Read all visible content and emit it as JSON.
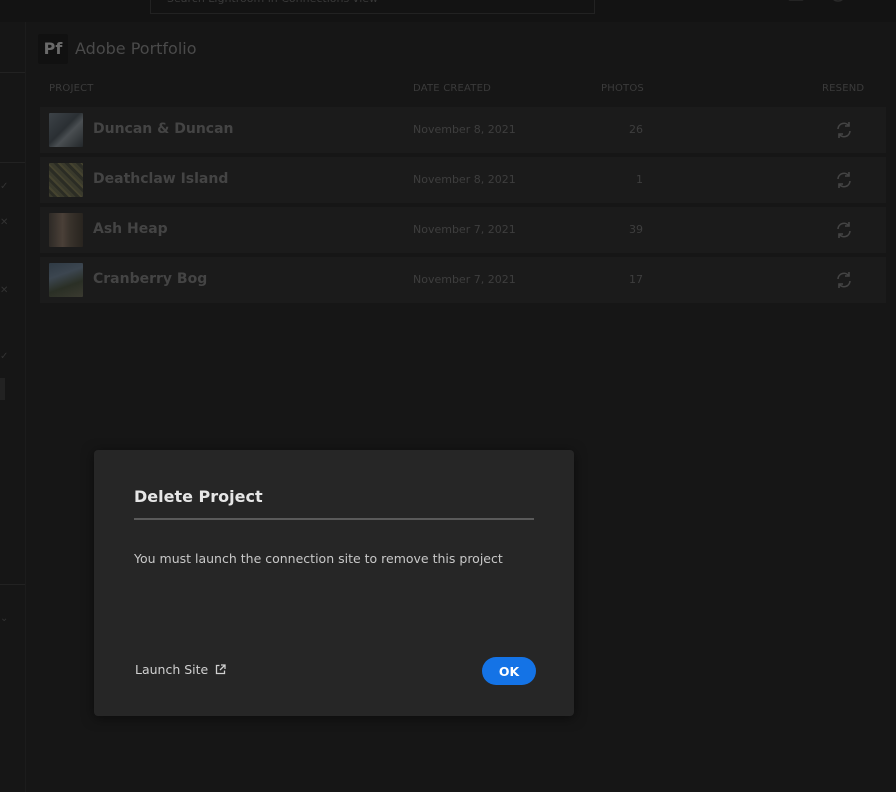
{
  "topbar": {
    "search_text": "Search Lightroom in Connections view"
  },
  "app": {
    "logo_text": "Pf",
    "title": "Adobe Portfolio"
  },
  "table": {
    "headers": {
      "project": "PROJECT",
      "date_created": "DATE CREATED",
      "photos": "PHOTOS",
      "resend": "RESEND"
    },
    "rows": [
      {
        "name": "Duncan & Duncan",
        "date": "November 8, 2021",
        "photos": "26"
      },
      {
        "name": "Deathclaw Island",
        "date": "November 8, 2021",
        "photos": "1"
      },
      {
        "name": "Ash Heap",
        "date": "November 7, 2021",
        "photos": "39"
      },
      {
        "name": "Cranberry Bog",
        "date": "November 7, 2021",
        "photos": "17"
      }
    ]
  },
  "modal": {
    "title": "Delete Project",
    "body": "You must launch the connection site to remove this project",
    "launch_label": "Launch Site",
    "ok_label": "OK"
  },
  "colors": {
    "accent": "#1473e6",
    "modal_bg": "#262626",
    "page_bg": "#151515"
  },
  "icons": {
    "resend": "refresh-icon",
    "launch": "external-link-icon"
  }
}
